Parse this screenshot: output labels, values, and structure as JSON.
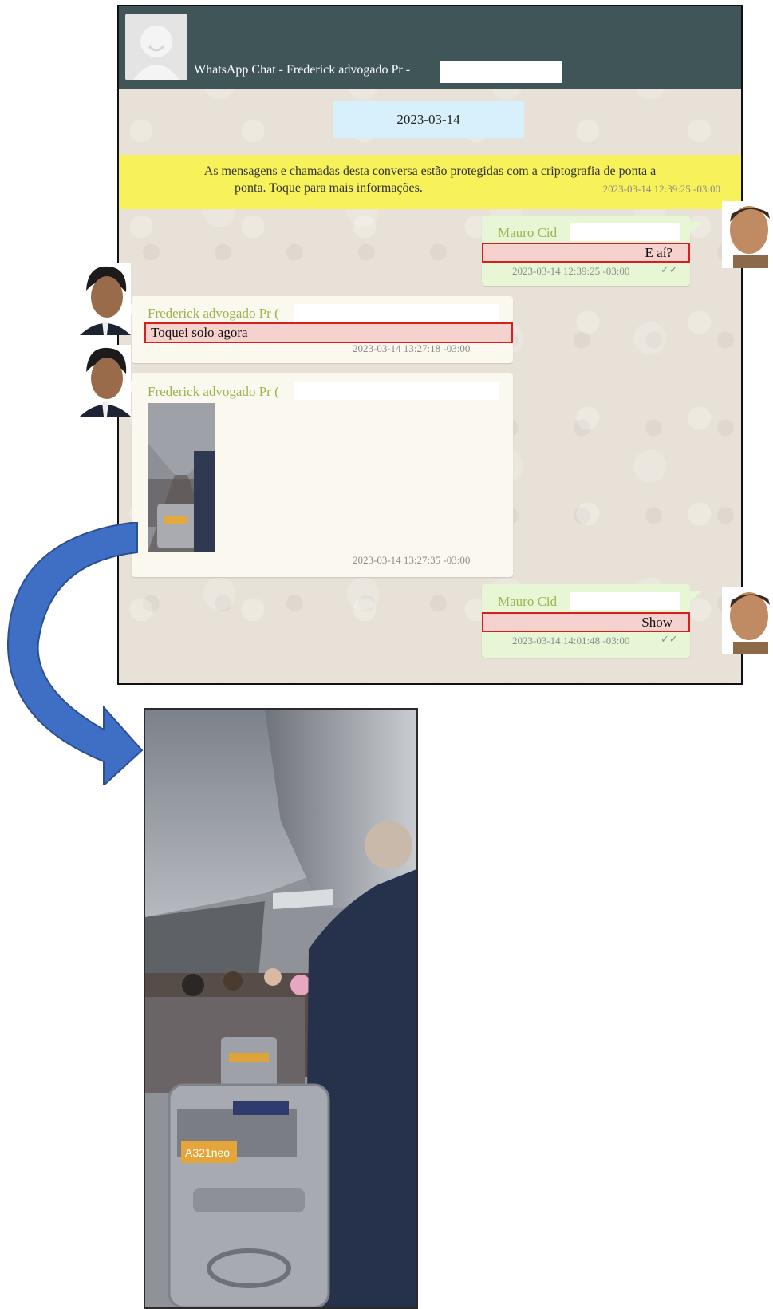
{
  "chat": {
    "title": "WhatsApp Chat - Frederick advogado Pr -",
    "date_pill": "2023-03-14",
    "encryption_notice": {
      "line1": "As mensagens e chamadas desta conversa estão protegidas com a criptografia de ponta a",
      "line2": "ponta. Toque para mais informações.",
      "timestamp": "2023-03-14 12:39:25 -03:00"
    },
    "messages": [
      {
        "sender": "Mauro Cid",
        "text": "E aí?",
        "timestamp": "2023-03-14 12:39:25 -03:00",
        "ticks": "✓✓"
      },
      {
        "sender": "Frederick advogado Pr (",
        "text": "Toquei solo agora",
        "timestamp": "2023-03-14 13:27:18 -03:00"
      },
      {
        "sender": "Frederick advogado Pr (",
        "attachment": "photo",
        "timestamp": "2023-03-14 13:27:35 -03:00"
      },
      {
        "sender": "Mauro Cid",
        "text": "Show",
        "timestamp": "2023-03-14 14:01:48 -03:00",
        "ticks": "✓✓"
      }
    ]
  },
  "photo": {
    "seat_placard": "A321neo"
  },
  "colors": {
    "header": "#3f5557",
    "notice": "#f7f15a",
    "date_pill": "#d7f0fb",
    "sender_name": "#9bb44e",
    "highlight_border": "#d81f1f",
    "arrow": "#3f6fc4"
  }
}
